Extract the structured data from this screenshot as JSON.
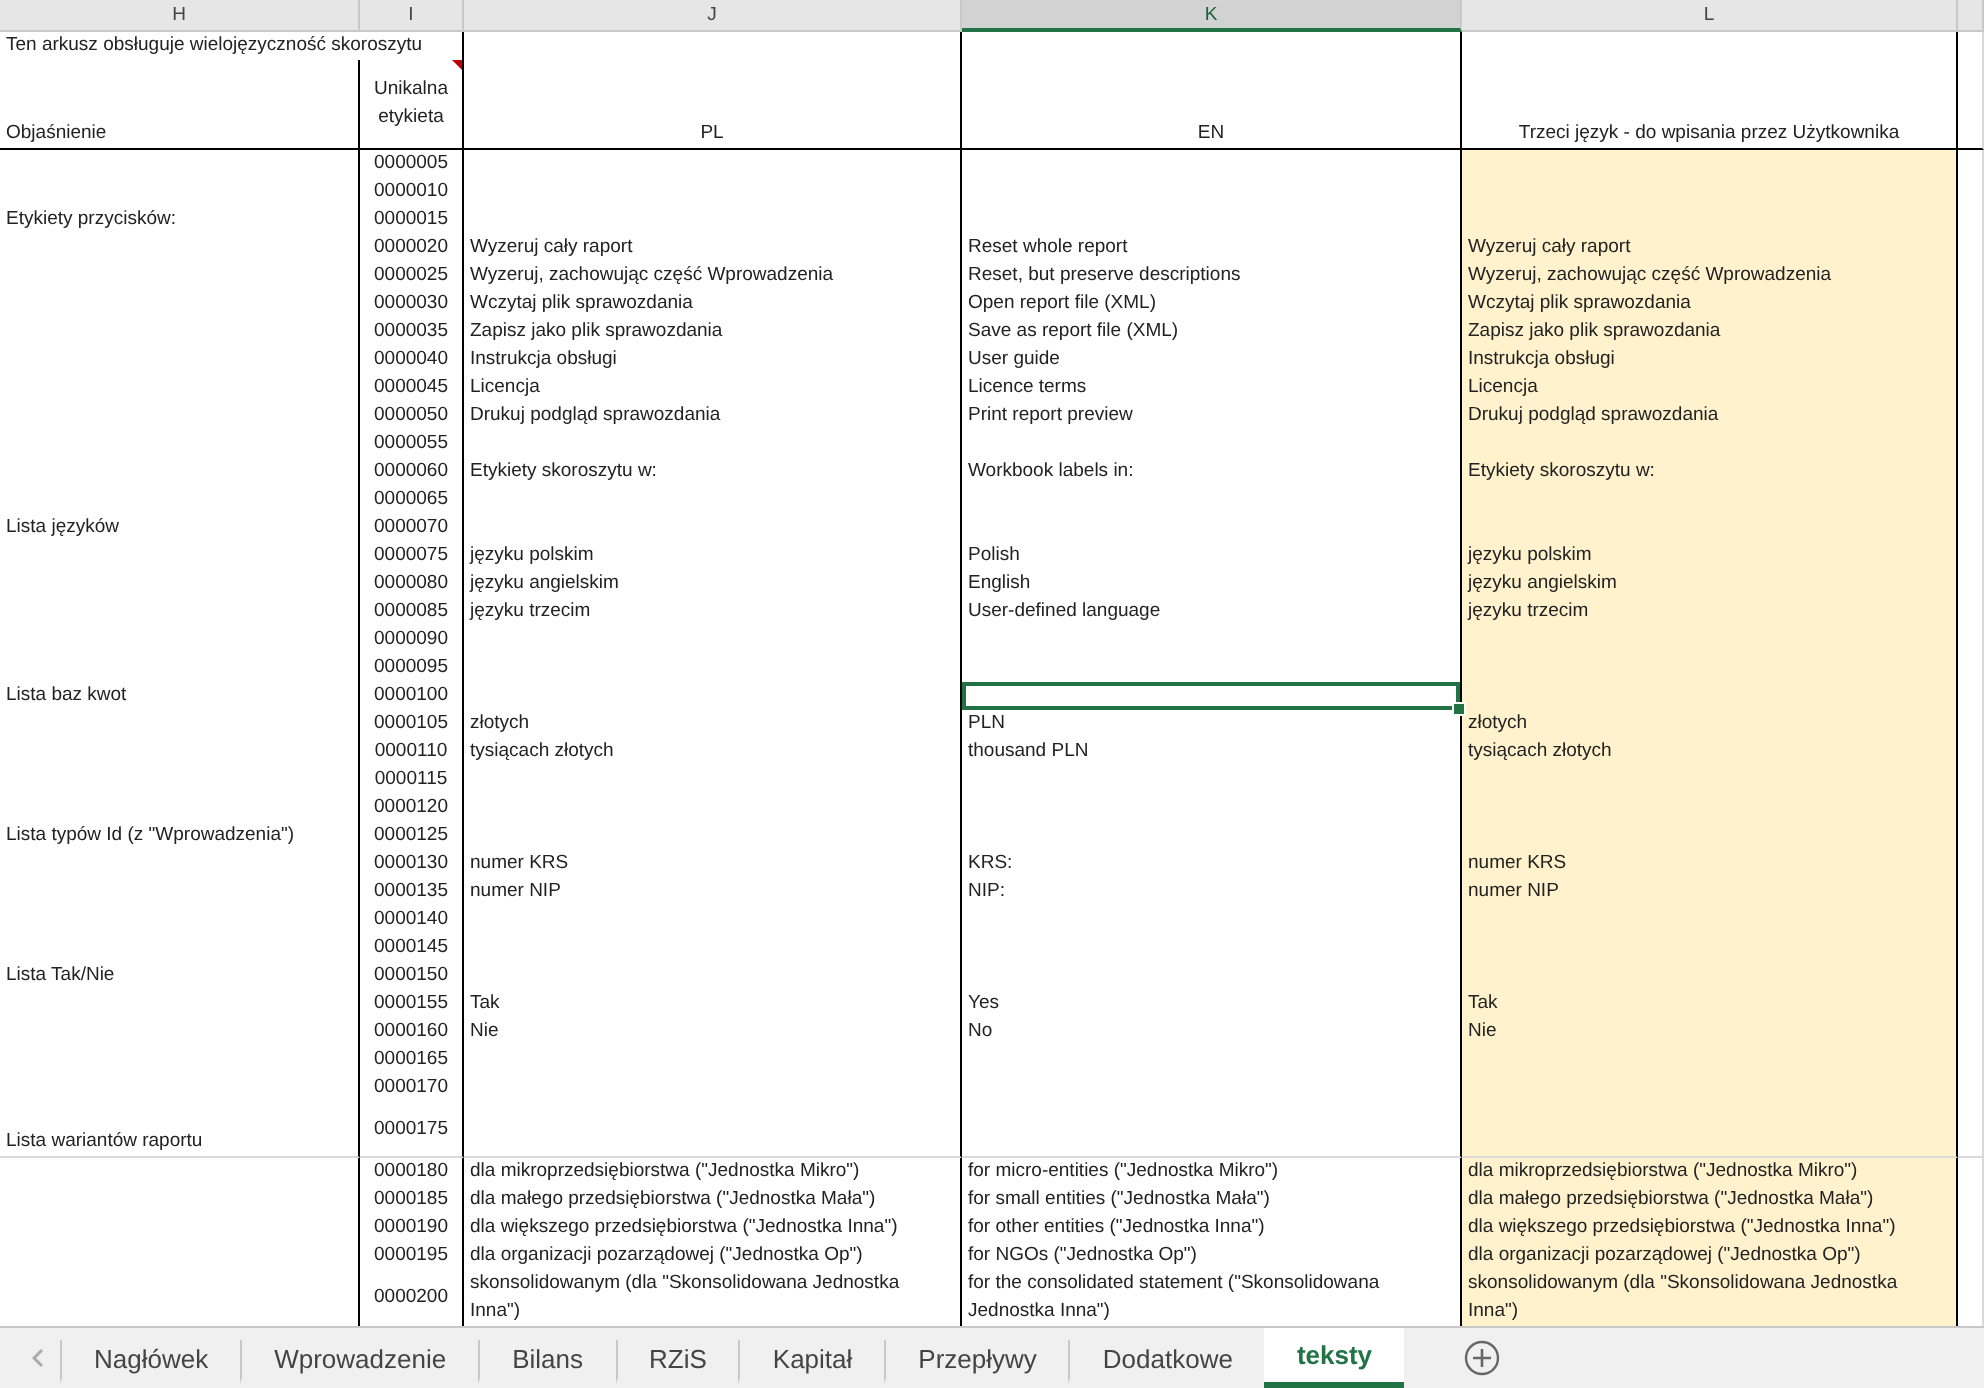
{
  "columns": [
    {
      "letter": "H",
      "selected": false
    },
    {
      "letter": "I",
      "selected": false
    },
    {
      "letter": "J",
      "selected": false
    },
    {
      "letter": "K",
      "selected": true
    },
    {
      "letter": "L",
      "selected": false
    }
  ],
  "title": "Ten arkusz obsługuje wielojęzyczność skoroszytu",
  "headers": {
    "explanation": "Objaśnienie",
    "id": "Unikalna etykieta",
    "pl": "PL",
    "en": "EN",
    "third": "Trzeci język - do wpisania przez Użytkownika"
  },
  "rows": [
    {
      "id": "0000005",
      "kind": "normal",
      "selected": false
    },
    {
      "id": "0000010",
      "kind": "normal",
      "selected": false
    },
    {
      "explanation": "Etykiety przycisków:",
      "id": "0000015",
      "kind": "normal",
      "selected": false
    },
    {
      "id": "0000020",
      "pl": "Wyzeruj cały raport",
      "en": "Reset whole report",
      "third": "Wyzeruj cały raport",
      "kind": "normal",
      "selected": false
    },
    {
      "id": "0000025",
      "pl": "Wyzeruj, zachowując część Wprowadzenia",
      "en": "Reset, but preserve descriptions",
      "third": "Wyzeruj, zachowując część Wprowadzenia",
      "kind": "normal",
      "selected": false
    },
    {
      "id": "0000030",
      "pl": "Wczytaj plik sprawozdania",
      "en": "Open report file (XML)",
      "third": "Wczytaj plik sprawozdania",
      "kind": "normal",
      "selected": false
    },
    {
      "id": "0000035",
      "pl": "Zapisz jako plik sprawozdania",
      "en": "Save as report file (XML)",
      "third": "Zapisz jako plik sprawozdania",
      "kind": "normal",
      "selected": false
    },
    {
      "id": "0000040",
      "pl": "Instrukcja obsługi",
      "en": "User guide",
      "third": "Instrukcja obsługi",
      "kind": "normal",
      "selected": false
    },
    {
      "id": "0000045",
      "pl": "Licencja",
      "en": "Licence terms",
      "third": "Licencja",
      "kind": "normal",
      "selected": false
    },
    {
      "id": "0000050",
      "pl": "Drukuj podgląd sprawozdania",
      "en": "Print report preview",
      "third": "Drukuj podgląd sprawozdania",
      "kind": "normal",
      "selected": false
    },
    {
      "id": "0000055",
      "kind": "normal",
      "selected": false
    },
    {
      "id": "0000060",
      "pl": "Etykiety skoroszytu w:",
      "en": "Workbook labels in:",
      "third": "Etykiety skoroszytu w:",
      "kind": "normal",
      "selected": false
    },
    {
      "id": "0000065",
      "kind": "normal",
      "selected": false
    },
    {
      "explanation": "Lista języków",
      "id": "0000070",
      "kind": "normal",
      "selected": false
    },
    {
      "id": "0000075",
      "pl": "języku polskim",
      "en": "Polish",
      "third": "języku polskim",
      "kind": "normal",
      "selected": false
    },
    {
      "id": "0000080",
      "pl": "języku angielskim",
      "en": "English",
      "third": "języku angielskim",
      "kind": "normal",
      "selected": false
    },
    {
      "id": "0000085",
      "pl": "języku trzecim",
      "en": "User-defined language",
      "third": "języku trzecim",
      "kind": "normal",
      "selected": false
    },
    {
      "id": "0000090",
      "kind": "normal",
      "selected": false
    },
    {
      "id": "0000095",
      "kind": "normal",
      "selected": false
    },
    {
      "explanation": "Lista baz kwot",
      "id": "0000100",
      "kind": "normal",
      "selected": true
    },
    {
      "id": "0000105",
      "pl": "złotych",
      "en": "PLN",
      "third": "złotych",
      "kind": "normal",
      "selected": false
    },
    {
      "id": "0000110",
      "pl": "tysiącach złotych",
      "en": "thousand PLN",
      "third": "tysiącach złotych",
      "kind": "normal",
      "selected": false
    },
    {
      "id": "0000115",
      "kind": "normal",
      "selected": false
    },
    {
      "id": "0000120",
      "kind": "normal",
      "selected": false
    },
    {
      "explanation": "Lista typów Id (z \"Wprowadzenia\")",
      "id": "0000125",
      "kind": "normal",
      "selected": false
    },
    {
      "id": "0000130",
      "pl": "numer KRS",
      "en": "KRS:",
      "third": "numer KRS",
      "kind": "normal",
      "selected": false
    },
    {
      "id": "0000135",
      "pl": "numer NIP",
      "en": "NIP:",
      "third": "numer NIP",
      "kind": "normal",
      "selected": false
    },
    {
      "id": "0000140",
      "kind": "normal",
      "selected": false
    },
    {
      "id": "0000145",
      "kind": "normal",
      "selected": false
    },
    {
      "explanation": "Lista Tak/Nie",
      "id": "0000150",
      "kind": "normal",
      "selected": false
    },
    {
      "id": "0000155",
      "pl": "Tak",
      "en": "Yes",
      "third": "Tak",
      "kind": "normal",
      "selected": false
    },
    {
      "id": "0000160",
      "pl": "Nie",
      "en": "No",
      "third": "Nie",
      "kind": "normal",
      "selected": false
    },
    {
      "id": "0000165",
      "kind": "normal",
      "selected": false
    },
    {
      "id": "0000170",
      "kind": "normal",
      "selected": false
    },
    {
      "explanation": "Lista wariantów raportu",
      "id": "0000175",
      "kind": "tall",
      "selected": false
    },
    {
      "id": "0000180",
      "pl": "dla mikroprzedsiębiorstwa (\"Jednostka Mikro\")",
      "en": "for micro-entities (\"Jednostka Mikro\")",
      "third": "dla mikroprzedsiębiorstwa (\"Jednostka Mikro\")",
      "kind": "normal",
      "selected": false
    },
    {
      "id": "0000185",
      "pl": "dla małego przedsiębiorstwa (\"Jednostka Mała\")",
      "en": "for small entities (\"Jednostka Mała\")",
      "third": "dla małego przedsiębiorstwa (\"Jednostka Mała\")",
      "kind": "normal",
      "selected": false
    },
    {
      "id": "0000190",
      "pl": "dla większego przedsiębiorstwa (\"Jednostka Inna\")",
      "en": "for other entities (\"Jednostka Inna\")",
      "third": "dla większego przedsiębiorstwa (\"Jednostka Inna\")",
      "kind": "normal",
      "selected": false
    },
    {
      "id": "0000195",
      "pl": "dla organizacji pozarządowej (\"Jednostka Op\")",
      "en": "for NGOs (\"Jednostka Op\")",
      "third": "dla organizacji pozarządowej (\"Jednostka Op\")",
      "kind": "normal",
      "selected": false
    },
    {
      "id": "0000200",
      "pl": "skonsolidowanym (dla \"Skonsolidowana Jednostka Inna\")",
      "en": "for the consolidated statement (\"Skonsolidowana Jednostka Inna\")",
      "third": "skonsolidowanym (dla \"Skonsolidowana Jednostka Inna\")",
      "kind": "tall",
      "selected": false
    }
  ],
  "tabs": [
    {
      "label": "Nagłówek",
      "selected": false
    },
    {
      "label": "Wprowadzenie",
      "selected": false
    },
    {
      "label": "Bilans",
      "selected": false
    },
    {
      "label": "RZiS",
      "selected": false
    },
    {
      "label": "Kapitał",
      "selected": false
    },
    {
      "label": "Przepływy",
      "selected": false
    },
    {
      "label": "Dodatkowe",
      "selected": false
    },
    {
      "label": "teksty",
      "selected": true
    }
  ]
}
